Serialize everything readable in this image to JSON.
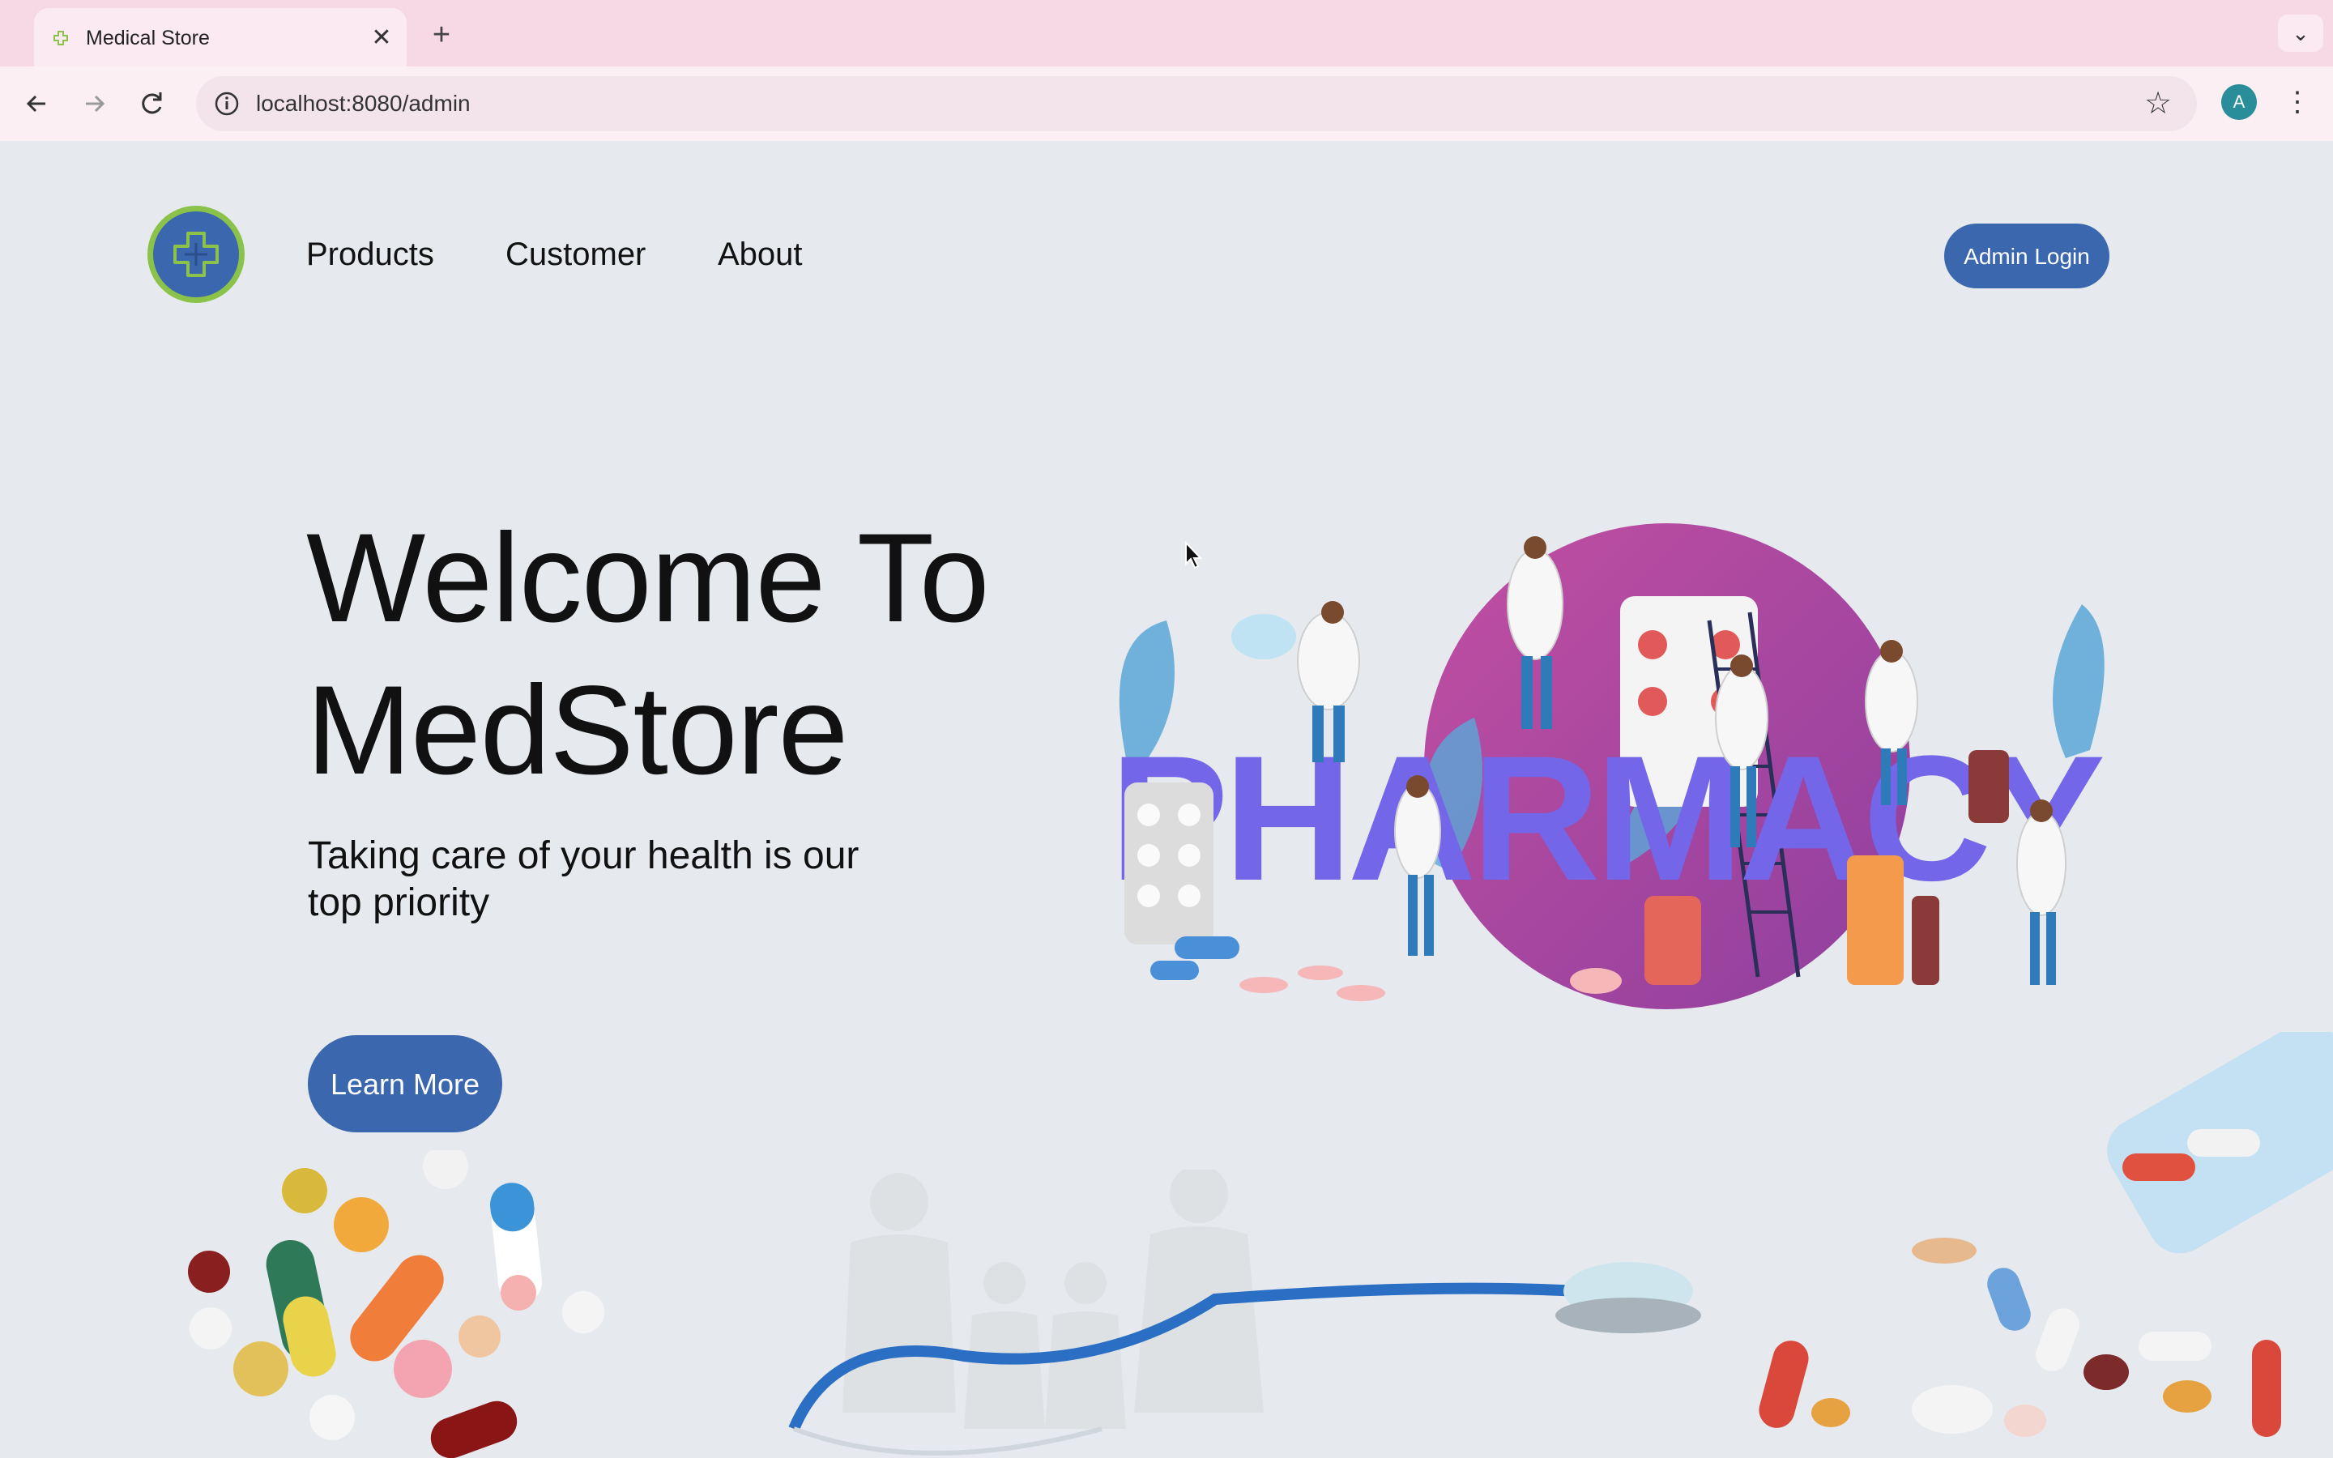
{
  "browser": {
    "tab_title": "Medical Store",
    "url": "localhost:8080/admin",
    "new_tab_symbol": "+",
    "close_symbol": "✕",
    "profile_initial": "A",
    "icons": [
      "favicon-icon",
      "close-icon",
      "plus-icon",
      "chevron-down-icon",
      "back-arrow-icon",
      "forward-arrow-icon",
      "reload-icon",
      "site-info-icon",
      "star-icon",
      "kebab-menu-icon"
    ]
  },
  "header": {
    "nav": {
      "products": "Products",
      "customer": "Customer",
      "about": "About"
    },
    "admin_login": "Admin Login"
  },
  "hero": {
    "title_line1": "Welcome To",
    "title_line2": "MedStore",
    "subtitle": "Taking care of your health is our top priority",
    "cta": "Learn More",
    "illustration_word": "PHARMACY"
  },
  "colors": {
    "accent": "#3a67ad",
    "page_bg": "#e6eaee",
    "logo_ring": "#8bc34a",
    "pharmacy_letters": "#7466e8",
    "circle": "#b25ba8"
  }
}
